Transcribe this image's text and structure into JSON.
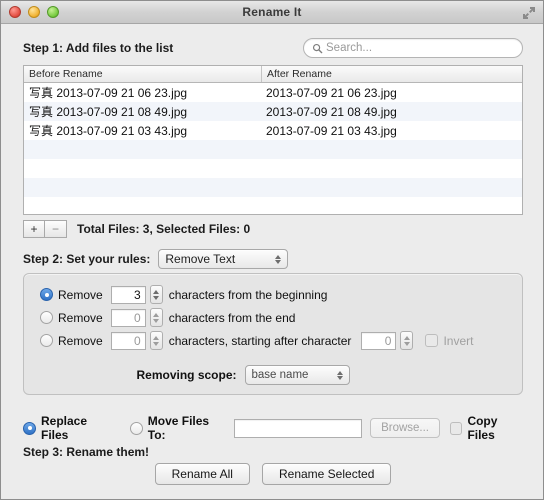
{
  "window": {
    "title": "Rename It",
    "traffic_lights": [
      "close",
      "minimize",
      "zoom"
    ],
    "fullscreen_icon": "fullscreen-arrows-icon"
  },
  "step1": {
    "label": "Step 1: Add files to the list",
    "search": {
      "placeholder": "Search...",
      "value": "",
      "icon": "search-icon"
    }
  },
  "file_table": {
    "columns": [
      "Before Rename",
      "After Rename"
    ],
    "rows": [
      {
        "before": "写真 2013-07-09 21 06 23.jpg",
        "after": "2013-07-09 21 06 23.jpg"
      },
      {
        "before": "写真 2013-07-09 21 08 49.jpg",
        "after": "2013-07-09 21 08 49.jpg"
      },
      {
        "before": "写真 2013-07-09 21 03 43.jpg",
        "after": "2013-07-09 21 03 43.jpg"
      }
    ]
  },
  "list_toolbar": {
    "add_label": "+",
    "remove_label": "−",
    "totals": "Total Files: 3,  Selected Files: 0"
  },
  "step2": {
    "label": "Step 2: Set your rules:",
    "rule_popup": {
      "value": "Remove Text"
    }
  },
  "rules": {
    "row1": {
      "selected": true,
      "remove_label": "Remove",
      "value": "3",
      "suffix": "characters from the beginning"
    },
    "row2": {
      "selected": false,
      "remove_label": "Remove",
      "value": "0",
      "suffix": "characters from the end"
    },
    "row3": {
      "selected": false,
      "remove_label": "Remove",
      "value": "0",
      "suffix": "characters, starting after character",
      "start_value": "0",
      "invert_label": "Invert",
      "invert_checked": false
    },
    "scope": {
      "label": "Removing scope:",
      "value": "base name"
    }
  },
  "destination": {
    "replace_label": "Replace Files",
    "replace_selected": true,
    "move_label": "Move Files To:",
    "move_selected": false,
    "path_value": "",
    "browse_label": "Browse...",
    "copy_label": "Copy Files",
    "copy_checked": false
  },
  "step3": {
    "label": "Step 3: Rename them!",
    "rename_all_label": "Rename All",
    "rename_selected_label": "Rename Selected"
  },
  "colors": {
    "window_bg": "#ececec",
    "accent_blue": "#2f72c6",
    "row_alt": "#f2f5fa"
  }
}
